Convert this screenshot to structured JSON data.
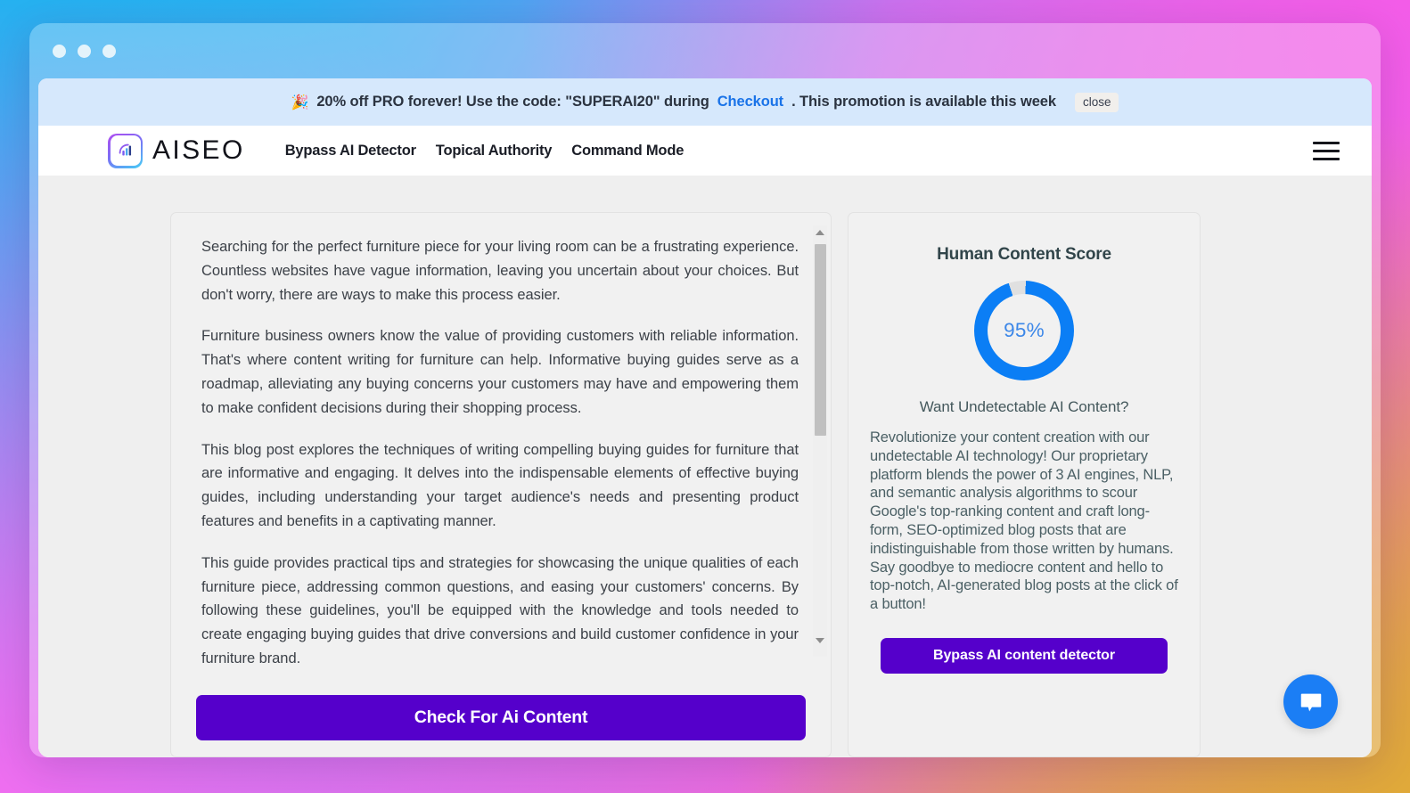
{
  "window": {
    "dots": [
      "close-dot",
      "minimize-dot",
      "maximize-dot"
    ]
  },
  "promo_banner": {
    "emoji": "🎉",
    "text_before_link": "20% off PRO forever! Use the code: \"SUPERAI20\" during",
    "link_label": "Checkout",
    "text_after_link": ". This promotion is available this week",
    "close_label": "close",
    "background_color": "#d6e8fc",
    "link_color": "#1a73e8"
  },
  "header": {
    "logo_text": "AISEO",
    "nav": [
      {
        "label": "Bypass AI Detector"
      },
      {
        "label": "Topical Authority"
      },
      {
        "label": "Command Mode"
      }
    ],
    "menu_icon": "hamburger-icon"
  },
  "editor": {
    "paragraphs": [
      "Searching for the perfect furniture piece for your living room can be a frustrating experience. Countless websites have vague information, leaving you uncertain about your choices. But don't worry, there are ways to make this process easier.",
      "Furniture business owners know the value of providing customers with reliable information. That's where content writing for furniture can help. Informative buying guides serve as a roadmap, alleviating any buying concerns your customers may have and empowering them to make confident decisions during their shopping process.",
      "This blog post explores the techniques of writing compelling buying guides for furniture that are informative and engaging. It delves into the indispensable elements of effective buying guides, including understanding your target audience's needs and presenting product features and benefits in a captivating manner.",
      "This guide provides practical tips and strategies for showcasing the unique qualities of each furniture piece, addressing common questions, and easing your customers' concerns. By following these guidelines, you'll be equipped with the knowledge and tools needed to create engaging buying guides that drive conversions and build customer confidence in your furniture brand."
    ],
    "check_button_label": "Check For Ai Content",
    "button_color": "#5500cb"
  },
  "score_panel": {
    "title": "Human Content Score",
    "score_value": "95%",
    "score_percent": 95,
    "ring_color": "#0b7ef5",
    "ring_track_color": "#e0e0e0",
    "subtitle": "Want Undetectable AI Content?",
    "description": "Revolutionize your content creation with our undetectable AI technology! Our proprietary platform blends the power of 3 AI engines, NLP, and semantic analysis algorithms to scour Google's top-ranking content and craft long-form, SEO-optimized blog posts that are indistinguishable from those written by humans. Say goodbye to mediocre content and hello to top-notch, AI-generated blog posts at the click of a button!",
    "bypass_button_label": "Bypass AI content detector"
  },
  "chat_widget": {
    "icon": "chat-bubble-icon",
    "color": "#1b7ef5"
  }
}
